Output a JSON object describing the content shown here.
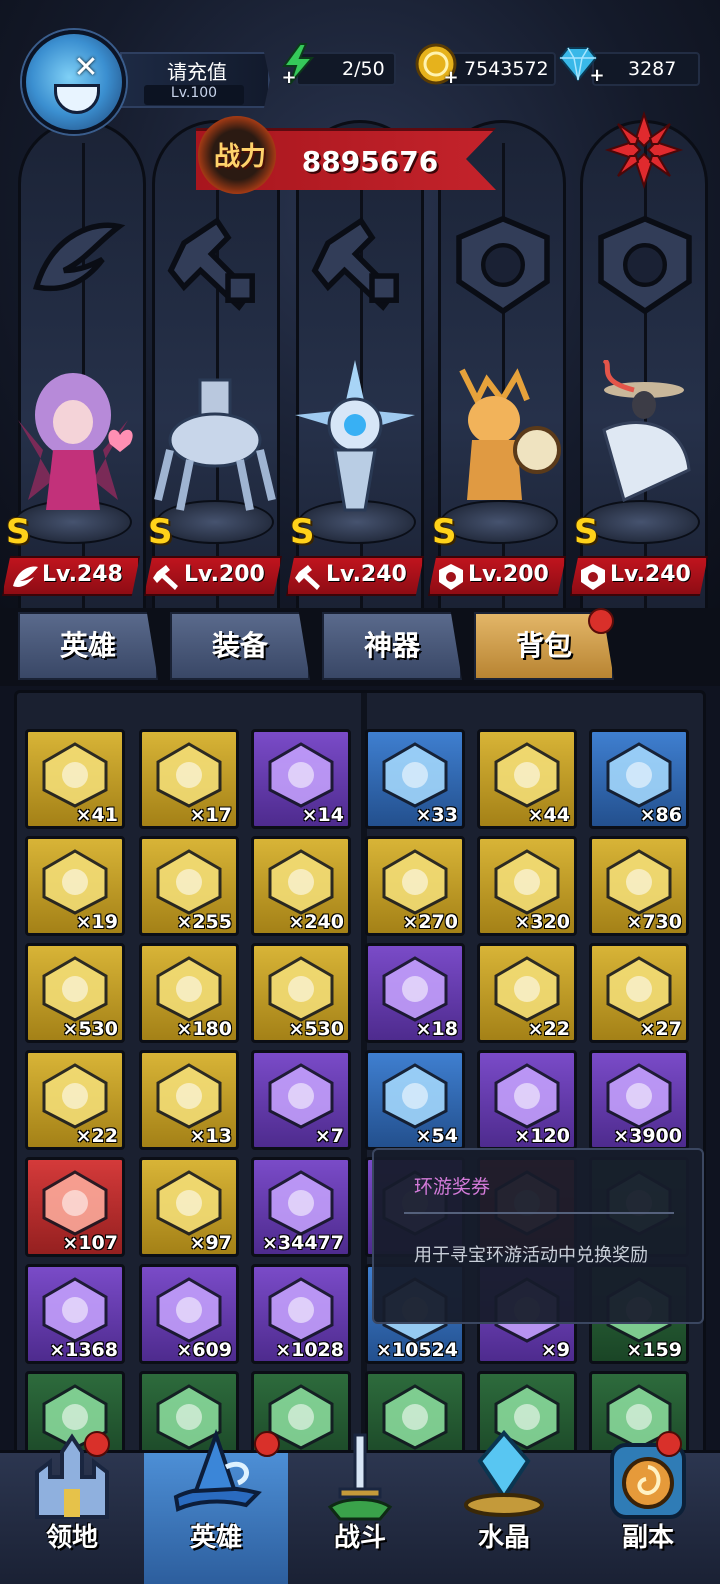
{
  "player": {
    "name": "请充值",
    "level": "Lv.100",
    "avatar_icon": "avatar-icon"
  },
  "resources": {
    "stamina": {
      "value": "2/50",
      "icon": "lightning-icon",
      "color": "#35c95a"
    },
    "gold": {
      "value": "7543572",
      "icon": "gold-coin-icon",
      "color": "#e6b21c"
    },
    "diamond": {
      "value": "3287",
      "icon": "diamond-icon",
      "color": "#39b8e8"
    }
  },
  "power": {
    "label": "战力",
    "value": "8895676"
  },
  "slots": [
    {
      "icon": "wing-slot-icon"
    },
    {
      "icon": "wrench-slot-icon"
    },
    {
      "icon": "wrench-slot-icon"
    },
    {
      "icon": "beast-slot-icon"
    },
    {
      "icon": "beast-slot-icon"
    }
  ],
  "heroes": [
    {
      "name": "succubus",
      "grade": "S",
      "level": "Lv.248",
      "class_icon": "wing-icon"
    },
    {
      "name": "mech-spider",
      "grade": "S",
      "level": "Lv.200",
      "class_icon": "wrench-icon"
    },
    {
      "name": "crystal-drone",
      "grade": "S",
      "level": "Lv.240",
      "class_icon": "wrench-icon"
    },
    {
      "name": "dragon-drummer",
      "grade": "S",
      "level": "Lv.200",
      "class_icon": "beast-icon"
    },
    {
      "name": "crane-sage",
      "grade": "S",
      "level": "Lv.240",
      "class_icon": "beast-icon"
    }
  ],
  "tabs": [
    {
      "label": "英雄",
      "active": false
    },
    {
      "label": "装备",
      "active": false
    },
    {
      "label": "神器",
      "active": false
    },
    {
      "label": "背包",
      "active": true
    }
  ],
  "inventory": [
    {
      "icon": "envelope-icon",
      "qty": "×41",
      "rarity": "gold"
    },
    {
      "icon": "crystal-shards-icon",
      "qty": "×17",
      "rarity": "gold"
    },
    {
      "icon": "scroll-icon",
      "qty": "×14",
      "rarity": "purple"
    },
    {
      "icon": "silver-scroll-icon",
      "qty": "×33",
      "rarity": "blue"
    },
    {
      "icon": "yellow-leaf-icon",
      "qty": "×44",
      "rarity": "gold"
    },
    {
      "icon": "green-leaf-icon",
      "qty": "×86",
      "rarity": "blue"
    },
    {
      "icon": "prism-icon",
      "qty": "×19",
      "rarity": "gold"
    },
    {
      "icon": "heart-box-icon",
      "qty": "×255",
      "rarity": "gold"
    },
    {
      "icon": "blue-hat-icon",
      "qty": "×240",
      "rarity": "gold"
    },
    {
      "icon": "radar-dish-icon",
      "qty": "×270",
      "rarity": "gold"
    },
    {
      "icon": "gourd-icon",
      "qty": "×320",
      "rarity": "gold"
    },
    {
      "icon": "sprout-icon",
      "qty": "×730",
      "rarity": "gold"
    },
    {
      "icon": "peach-icon",
      "qty": "×530",
      "rarity": "gold"
    },
    {
      "icon": "brass-tower-icon",
      "qty": "×180",
      "rarity": "gold"
    },
    {
      "icon": "ring-orb-icon",
      "qty": "×530",
      "rarity": "gold"
    },
    {
      "icon": "wing-emblem-icon",
      "qty": "×18",
      "rarity": "purple"
    },
    {
      "icon": "blue-beast-emblem-icon",
      "qty": "×22",
      "rarity": "gold"
    },
    {
      "icon": "green-beast-emblem-icon",
      "qty": "×27",
      "rarity": "gold"
    },
    {
      "icon": "bird-emblem-icon",
      "qty": "×22",
      "rarity": "gold"
    },
    {
      "icon": "dragon-emblem-icon",
      "qty": "×13",
      "rarity": "gold"
    },
    {
      "icon": "crystal-emblem-icon",
      "qty": "×7",
      "rarity": "purple"
    },
    {
      "icon": "blue-gem-emblem-icon",
      "qty": "×54",
      "rarity": "blue"
    },
    {
      "icon": "lightning-crystal-icon",
      "qty": "×120",
      "rarity": "purple"
    },
    {
      "icon": "star-map-icon",
      "qty": "×3900",
      "rarity": "purple"
    },
    {
      "icon": "rainbow-swirl-icon",
      "qty": "×107",
      "rarity": "red"
    },
    {
      "icon": "red-swirl-icon",
      "qty": "×97",
      "rarity": "gold"
    },
    {
      "icon": "teal-swirl-icon",
      "qty": "×34477",
      "rarity": "purple"
    },
    {
      "icon": "gray-swirl-icon",
      "qty": "",
      "rarity": "purple"
    },
    {
      "icon": "red-orb-icon",
      "qty": "",
      "rarity": "red"
    },
    {
      "icon": "green-crystal-icon",
      "qty": "",
      "rarity": "green"
    },
    {
      "icon": "blue-pyramid-icon",
      "qty": "×1368",
      "rarity": "purple"
    },
    {
      "icon": "gear-ring-icon",
      "qty": "×609",
      "rarity": "purple"
    },
    {
      "icon": "horn-icon",
      "qty": "×1028",
      "rarity": "purple"
    },
    {
      "icon": "blue-orb-icon",
      "qty": "×10524",
      "rarity": "blue"
    },
    {
      "icon": "shard-icon",
      "qty": "×9",
      "rarity": "purple"
    },
    {
      "icon": "green-rune-icon",
      "qty": "×159",
      "rarity": "green"
    },
    {
      "icon": "green-rune-icon",
      "qty": "",
      "rarity": "green"
    },
    {
      "icon": "green-rune-icon",
      "qty": "",
      "rarity": "green"
    },
    {
      "icon": "green-rune-icon",
      "qty": "",
      "rarity": "green"
    },
    {
      "icon": "green-rune-icon",
      "qty": "",
      "rarity": "green"
    },
    {
      "icon": "green-rune-icon",
      "qty": "",
      "rarity": "green"
    },
    {
      "icon": "green-rune-icon",
      "qty": "",
      "rarity": "green"
    }
  ],
  "tooltip": {
    "title": "环游奖券",
    "description": "用于寻宝环游活动中兑换奖励"
  },
  "bottom_nav": [
    {
      "label": "领地",
      "icon": "castle-icon",
      "active": false,
      "badge": true
    },
    {
      "label": "英雄",
      "icon": "wizard-hat-icon",
      "active": true,
      "badge": true
    },
    {
      "label": "战斗",
      "icon": "sword-icon",
      "active": false,
      "badge": false
    },
    {
      "label": "水晶",
      "icon": "crystal-icon",
      "active": false,
      "badge": false
    },
    {
      "label": "副本",
      "icon": "portal-icon",
      "active": false,
      "badge": true
    }
  ]
}
